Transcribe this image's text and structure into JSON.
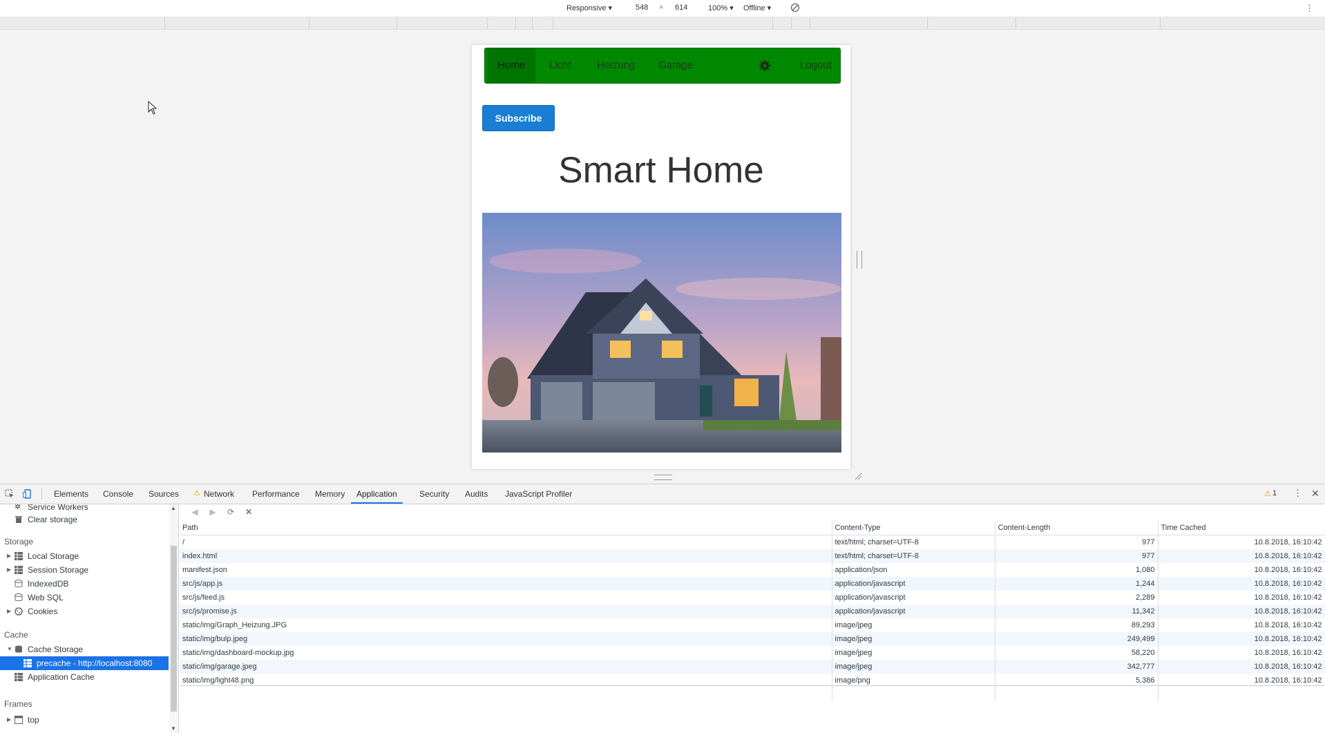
{
  "device_toolbar": {
    "device": "Responsive ▾",
    "width": "548",
    "times": "×",
    "height": "614",
    "zoom": "100% ▾",
    "network": "Offline ▾"
  },
  "page": {
    "nav": {
      "items": [
        "Home",
        "Licht",
        "Heizung",
        "Garage"
      ],
      "logout": "Logout"
    },
    "subscribe_label": "Subscribe",
    "title": "Smart Home"
  },
  "devtools": {
    "tabs": [
      "Elements",
      "Console",
      "Sources",
      "Network",
      "Performance",
      "Memory",
      "Application",
      "Security",
      "Audits",
      "JavaScript Profiler"
    ],
    "active_tab": "Application",
    "warnings": "1",
    "sidebar": {
      "app_items": [
        "Service Workers",
        "Clear storage"
      ],
      "storage_header": "Storage",
      "storage_items": [
        "Local Storage",
        "Session Storage",
        "IndexedDB",
        "Web SQL",
        "Cookies"
      ],
      "cache_header": "Cache",
      "cache_items": [
        "Cache Storage",
        "precache - http://localhost:8080",
        "Application Cache"
      ],
      "frames_header": "Frames",
      "frames_items": [
        "top"
      ]
    },
    "table": {
      "columns": [
        "Path",
        "Content-Type",
        "Content-Length",
        "Time Cached"
      ],
      "rows": [
        {
          "path": "/",
          "type": "text/html; charset=UTF-8",
          "length": "977",
          "time": "10.8.2018, 16:10:42"
        },
        {
          "path": "index.html",
          "type": "text/html; charset=UTF-8",
          "length": "977",
          "time": "10.8.2018, 16:10:42"
        },
        {
          "path": "manifest.json",
          "type": "application/json",
          "length": "1,080",
          "time": "10.8.2018, 16:10:42"
        },
        {
          "path": "src/js/app.js",
          "type": "application/javascript",
          "length": "1,244",
          "time": "10.8.2018, 16:10:42"
        },
        {
          "path": "src/js/feed.js",
          "type": "application/javascript",
          "length": "2,289",
          "time": "10.8.2018, 16:10:42"
        },
        {
          "path": "src/js/promise.js",
          "type": "application/javascript",
          "length": "11,342",
          "time": "10.8.2018, 16:10:42"
        },
        {
          "path": "static/img/Graph_Heizung.JPG",
          "type": "image/jpeg",
          "length": "89,293",
          "time": "10.8.2018, 16:10:42"
        },
        {
          "path": "static/img/bulp.jpeg",
          "type": "image/jpeg",
          "length": "249,499",
          "time": "10.8.2018, 16:10:42"
        },
        {
          "path": "static/img/dashboard-mockup.jpg",
          "type": "image/jpeg",
          "length": "58,220",
          "time": "10.8.2018, 16:10:42"
        },
        {
          "path": "static/img/garage.jpeg",
          "type": "image/jpeg",
          "length": "342,777",
          "time": "10.8.2018, 16:10:42"
        },
        {
          "path": "static/img/light48.png",
          "type": "image/png",
          "length": "5,386",
          "time": "10.8.2018, 16:10:42"
        }
      ]
    }
  },
  "colors": {
    "navbar": "#008800",
    "subscribe": "#1a7fd4",
    "devtools_accent": "#1a73e8"
  }
}
